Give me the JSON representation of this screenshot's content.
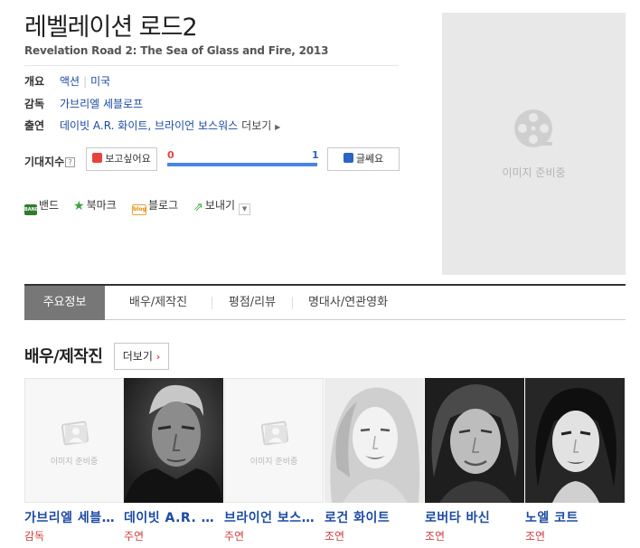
{
  "movie": {
    "title": "레벨레이션 로드2",
    "subtitle": "Revelation Road 2: The Sea of Glass and Fire, 2013"
  },
  "info": {
    "overview_label": "개요",
    "genre": "액션",
    "country": "미국",
    "director_label": "감독",
    "director": "가브리엘 세블로프",
    "cast_label": "출연",
    "cast": "데이빗 A.R. 화이트, 브라이언 보스워스",
    "more": "더보기"
  },
  "expect": {
    "label": "기대지수",
    "help": "?",
    "like_label": "보고싶어요",
    "dislike_label": "글쎄요",
    "like_count": "0",
    "dislike_count": "1",
    "like_ratio": 0.0,
    "dislike_ratio": 1.0,
    "like_color": "#e8423c",
    "dislike_color": "#4a86e0"
  },
  "share": {
    "band": "밴드",
    "band_icon_text": "BAND",
    "bookmark": "북마크",
    "blog": "블로그",
    "blog_icon_text": "blog",
    "send": "보내기"
  },
  "poster": {
    "placeholder": "이미지 준비중"
  },
  "tabs": [
    {
      "label": "주요정보",
      "active": true
    },
    {
      "label": "배우/제작진",
      "active": false
    },
    {
      "label": "평점/리뷰",
      "active": false
    },
    {
      "label": "명대사/연관영화",
      "active": false
    }
  ],
  "cast_section": {
    "title": "배우/제작진",
    "more": "더보기"
  },
  "people": [
    {
      "name": "가브리엘 세블로프",
      "role": "감독",
      "image": "placeholder",
      "placeholder_text": "이미지 준비중"
    },
    {
      "name": "데이빗 A.R. 화이트",
      "role": "주연",
      "image": "photo"
    },
    {
      "name": "브라이언 보스워스",
      "role": "주연",
      "image": "placeholder",
      "placeholder_text": "이미지 준비중"
    },
    {
      "name": "로건 화이트",
      "role": "조연",
      "image": "photo"
    },
    {
      "name": "로버타 바신",
      "role": "조연",
      "image": "photo"
    },
    {
      "name": "노엘 코트",
      "role": "조연",
      "image": "photo"
    }
  ]
}
